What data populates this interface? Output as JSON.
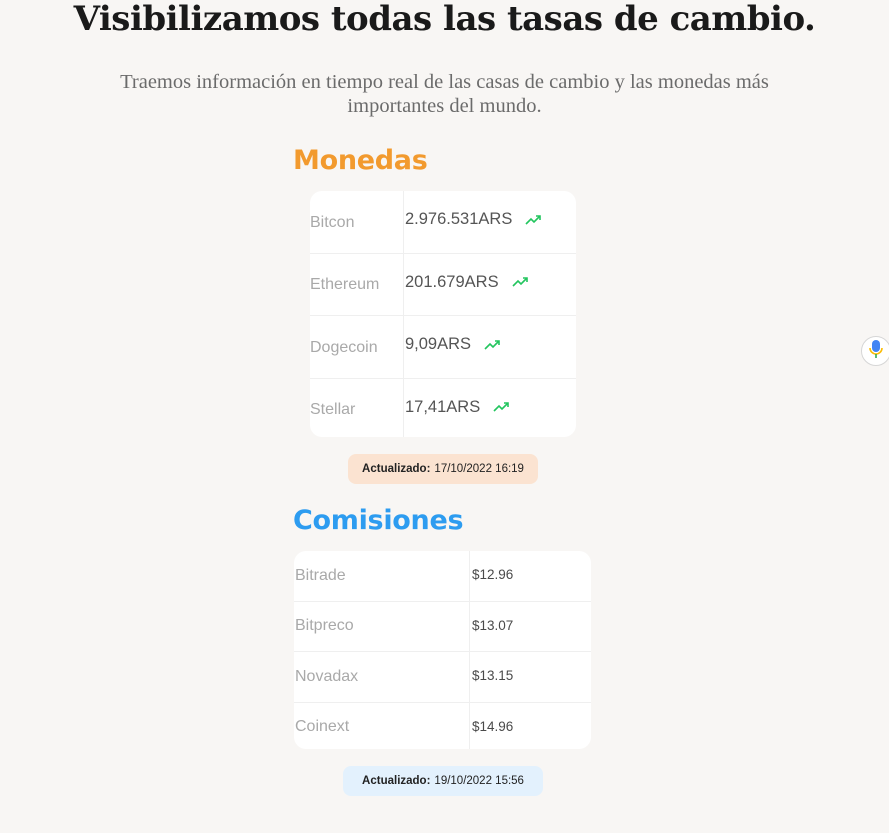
{
  "header": {
    "title": "Visibilizamos todas las tasas de cambio.",
    "subtitle": "Traemos información en tiempo real de las casas de cambio y las monedas más importantes del mundo."
  },
  "monedas": {
    "title": "Monedas",
    "rows": [
      {
        "name": "Bitcon",
        "value": "2.976.531ARS",
        "trend": "trending-up-icon"
      },
      {
        "name": "Ethereum",
        "value": "201.679ARS",
        "trend": "trending-up-icon"
      },
      {
        "name": "Dogecoin",
        "value": "9,09ARS",
        "trend": "trending-up-icon"
      },
      {
        "name": "Stellar",
        "value": "17,41ARS",
        "trend": "trending-up-icon"
      }
    ],
    "updated_label": "Actualizado:",
    "updated_value": "17/10/2022 16:19"
  },
  "comisiones": {
    "title": "Comisiones",
    "rows": [
      {
        "name": "Bitrade",
        "value": "$12.96"
      },
      {
        "name": "Bitpreco",
        "value": "$13.07"
      },
      {
        "name": "Novadax",
        "value": "$13.15"
      },
      {
        "name": "Coinext",
        "value": "$14.96"
      }
    ],
    "updated_label": "Actualizado:",
    "updated_value": "19/10/2022 15:56"
  },
  "colors": {
    "monedas_accent": "#f29a2e",
    "comisiones_accent": "#2d9cf0",
    "trend_up": "#22c55e"
  },
  "floating": {
    "icon": "microphone-icon"
  }
}
